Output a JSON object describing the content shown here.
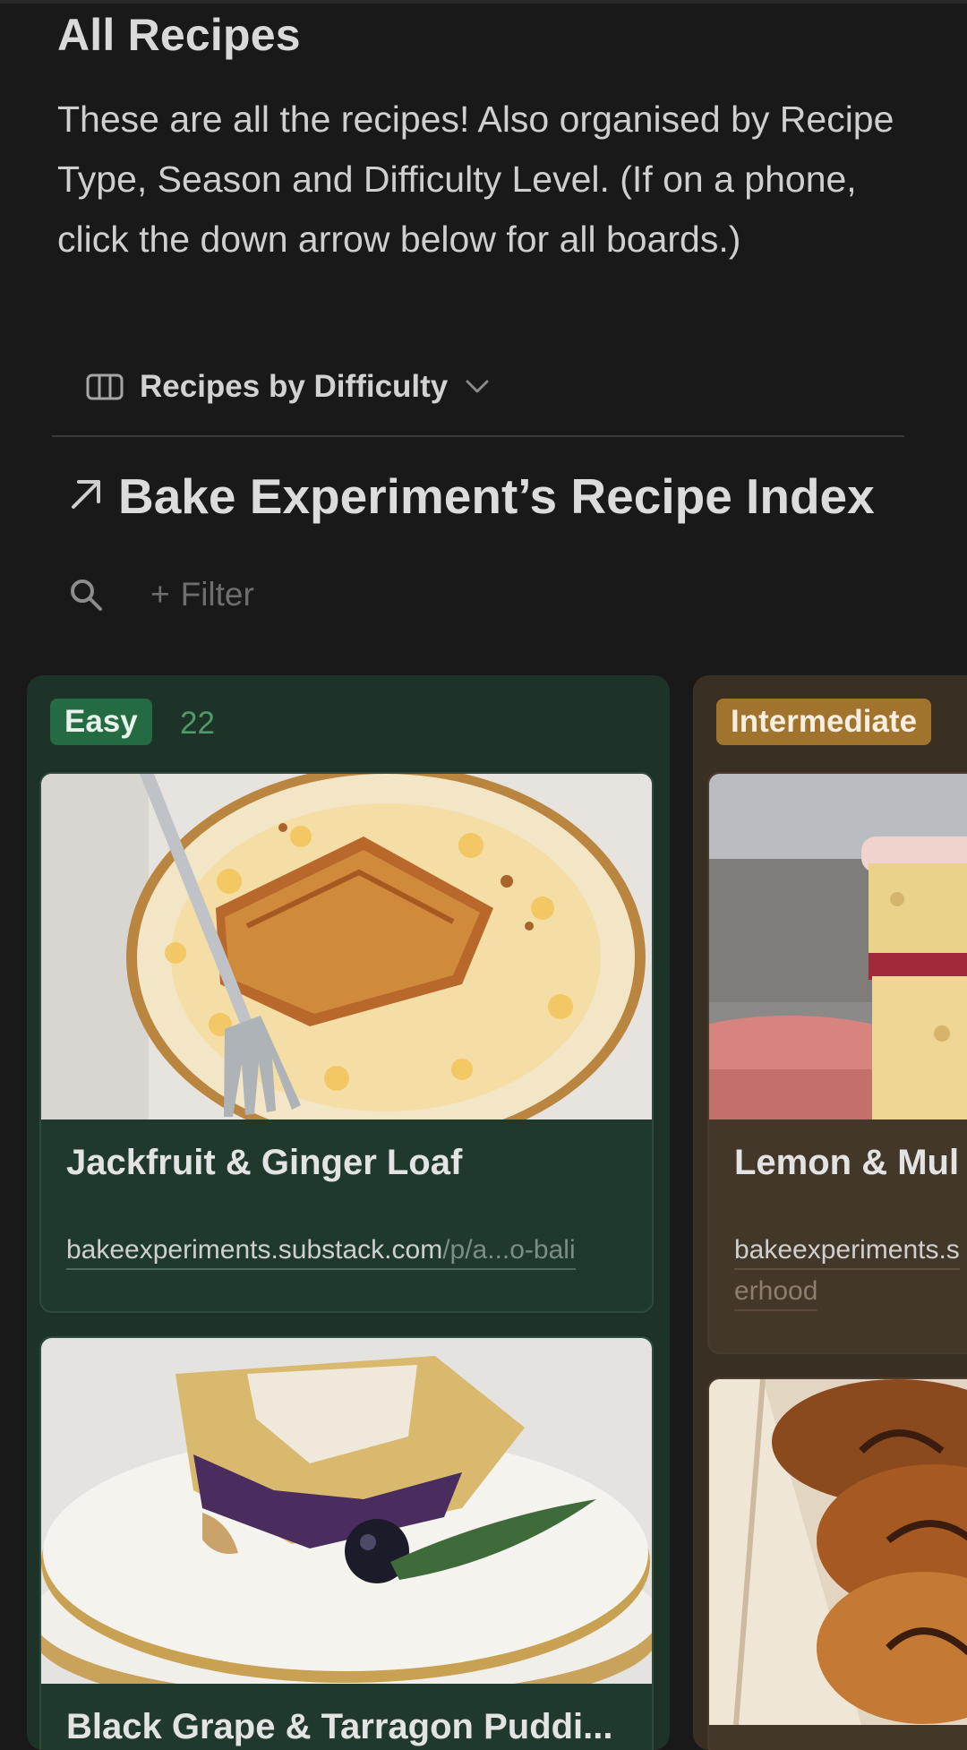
{
  "page": {
    "title": "All Recipes",
    "description": "These are all the recipes! Also organised by Recipe Type, Season and Difficulty Level. (If on a phone, click the down arrow below for all boards.)"
  },
  "view_switcher": {
    "label": "Recipes by Difficulty",
    "icon": "board-view-icon",
    "dropdown_icon": "chevron-down-icon"
  },
  "database": {
    "title": "Bake Experiment’s Recipe Index",
    "link_icon": "arrow-up-right-icon"
  },
  "toolbar": {
    "search_icon": "search-icon",
    "filter_label": "Filter",
    "filter_prefix": "+"
  },
  "groups": [
    {
      "label": "Easy",
      "count": "22",
      "color": "#246a43",
      "cards": [
        {
          "title": "Jackfruit & Ginger Loaf",
          "url_main": "bakeexperiments.substack.com",
          "url_rest": "/p/a...o-bali"
        },
        {
          "title": "Black Grape & Tarragon Puddi..."
        }
      ]
    },
    {
      "label": "Intermediate",
      "color": "#a0742d",
      "cards": [
        {
          "title": "Lemon & Mul",
          "url_main": "bakeexperiments.s",
          "url_rest": "erhood"
        },
        {
          "title": ""
        }
      ]
    }
  ]
}
